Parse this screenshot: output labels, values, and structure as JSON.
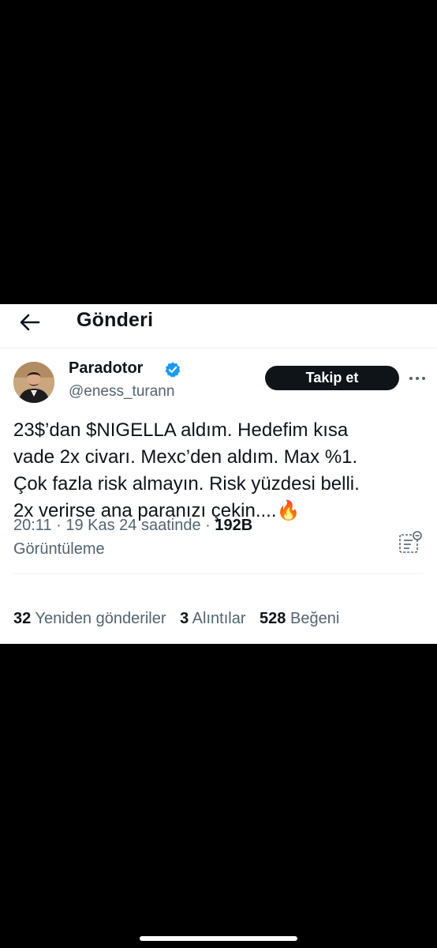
{
  "header": {
    "title": "Gönderi"
  },
  "author": {
    "name": "Paradotor",
    "handle": "@eness_turann",
    "follow_label": "Takip et"
  },
  "tweet": {
    "lines": [
      "23$’dan $NIGELLA aldım. Hedefim kısa",
      "vade  2x civarı. Mexc’den aldım. Max %1.",
      "Çok fazla risk almayın. Risk yüzdesi belli.",
      "2x verirse ana paranızı çekin....🔥"
    ]
  },
  "meta": {
    "time": "20:11",
    "separator": " · ",
    "date": "19 Kas 24 saatinde",
    "views_count": "192B",
    "views_label": "Görüntüleme"
  },
  "stats": {
    "reposts": {
      "count": "32",
      "label": "Yeniden gönderiler"
    },
    "quotes": {
      "count": "3",
      "label": "Alıntılar"
    },
    "likes": {
      "count": "528",
      "label": "Beğeni"
    }
  },
  "colors": {
    "background": "#000000",
    "card": "#ffffff",
    "text": "#0f1419",
    "secondary": "#536471",
    "verified": "#1d9bf0",
    "follow_button": "#0f1419"
  },
  "icons": {
    "back": "arrow-left-icon",
    "verified": "verified-badge-icon",
    "more": "more-horizontal-icon",
    "analytics": "analytics-icon",
    "fire": "fire-emoji"
  }
}
